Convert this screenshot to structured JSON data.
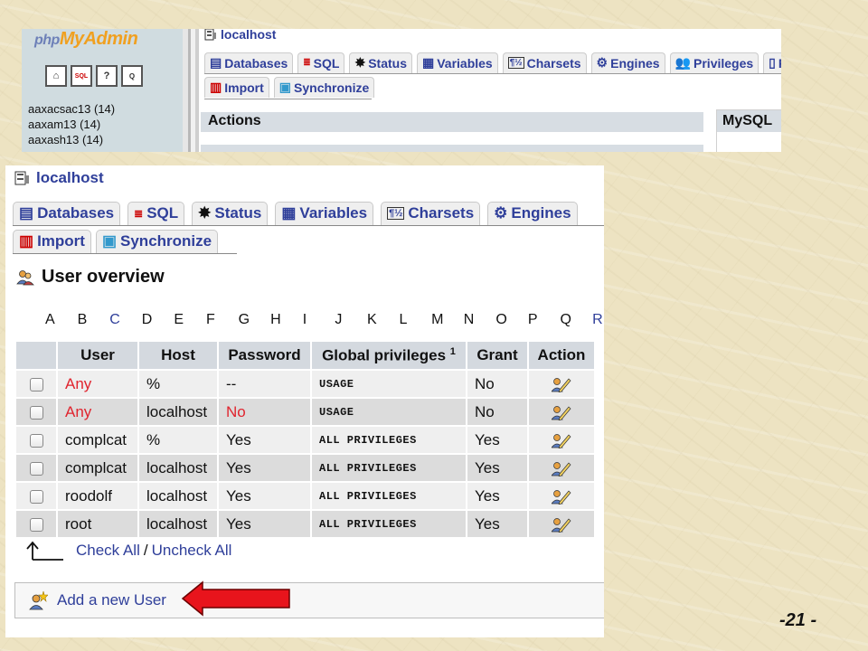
{
  "top_screenshot": {
    "logo": {
      "php": "php",
      "myadmin": "MyAdmin"
    },
    "nav_icons": [
      "home-icon",
      "sql-icon",
      "docs-icon",
      "query-icon"
    ],
    "databases": [
      "aaxacsac13 (14)",
      "aaxam13 (14)",
      "aaxash13 (14)"
    ],
    "host": "localhost",
    "tabs": [
      "Databases",
      "SQL",
      "Status",
      "Variables",
      "Charsets",
      "Engines",
      "Privileges",
      "Re"
    ],
    "tabs_row2": [
      "Import",
      "Synchronize"
    ],
    "actions_heading": "Actions",
    "mysql_heading": "MySQL"
  },
  "main": {
    "host": "localhost",
    "tabs": [
      "Databases",
      "SQL",
      "Status",
      "Variables",
      "Charsets",
      "Engines"
    ],
    "tabs_row2": [
      "Import",
      "Synchronize"
    ],
    "title": "User overview",
    "letters": [
      "A",
      "B",
      "C",
      "D",
      "E",
      "F",
      "G",
      "H",
      "I",
      "J",
      "K",
      "L",
      "M",
      "N",
      "O",
      "P",
      "Q",
      "R"
    ],
    "table": {
      "headers": [
        "User",
        "Host",
        "Password",
        "Global privileges",
        "Grant",
        "Action"
      ],
      "footnote_mark": "1",
      "rows": [
        {
          "user": "Any",
          "host": "%",
          "password": "--",
          "privileges": "USAGE",
          "grant": "No"
        },
        {
          "user": "Any",
          "host": "localhost",
          "password": "No",
          "privileges": "USAGE",
          "grant": "No"
        },
        {
          "user": "complcat",
          "host": "%",
          "password": "Yes",
          "privileges": "ALL PRIVILEGES",
          "grant": "Yes"
        },
        {
          "user": "complcat",
          "host": "localhost",
          "password": "Yes",
          "privileges": "ALL PRIVILEGES",
          "grant": "Yes"
        },
        {
          "user": "roodolf",
          "host": "localhost",
          "password": "Yes",
          "privileges": "ALL PRIVILEGES",
          "grant": "Yes"
        },
        {
          "user": "root",
          "host": "localhost",
          "password": "Yes",
          "privileges": "ALL PRIVILEGES",
          "grant": "Yes"
        }
      ]
    },
    "check_all": "Check All",
    "separator": "/",
    "uncheck_all": "Uncheck All",
    "add_user": "Add a new User"
  },
  "colors": {
    "link": "#2f3f9a",
    "red": "#e0242e",
    "arrow": "#e8141c"
  },
  "page_number": "-21 -"
}
